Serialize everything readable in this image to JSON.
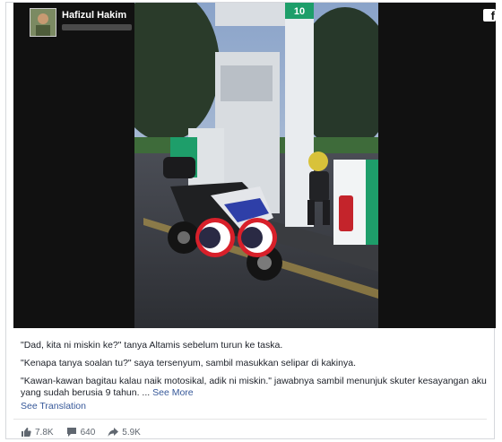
{
  "header": {
    "author_name": "Hafizul Hakim",
    "brand_icon": "facebook-icon"
  },
  "photo": {
    "pump_number": "10"
  },
  "caption": {
    "line1": "\"Dad, kita ni miskin ke?\" tanya Altamis sebelum turun ke taska.",
    "line2": "\"Kenapa tanya soalan tu?\" saya tersenyum, sambil masukkan selipar di kakinya.",
    "line3": "\"Kawan-kawan bagitau kalau naik motosikal, adik ni miskin.\" jawabnya sambil menunjuk skuter kesayangan aku yang sudah berusia 9 tahun. ...",
    "see_more": "See More",
    "see_translation": "See Translation"
  },
  "stats": {
    "likes": "7.8K",
    "comments": "640",
    "shares": "5.9K",
    "icons": [
      "like-icon",
      "comment-icon",
      "share-icon"
    ]
  },
  "colors": {
    "link": "#365899",
    "text": "#1d2129",
    "meta": "#606770",
    "dark_bg": "#111111",
    "station_green": "#1e9e6a"
  }
}
